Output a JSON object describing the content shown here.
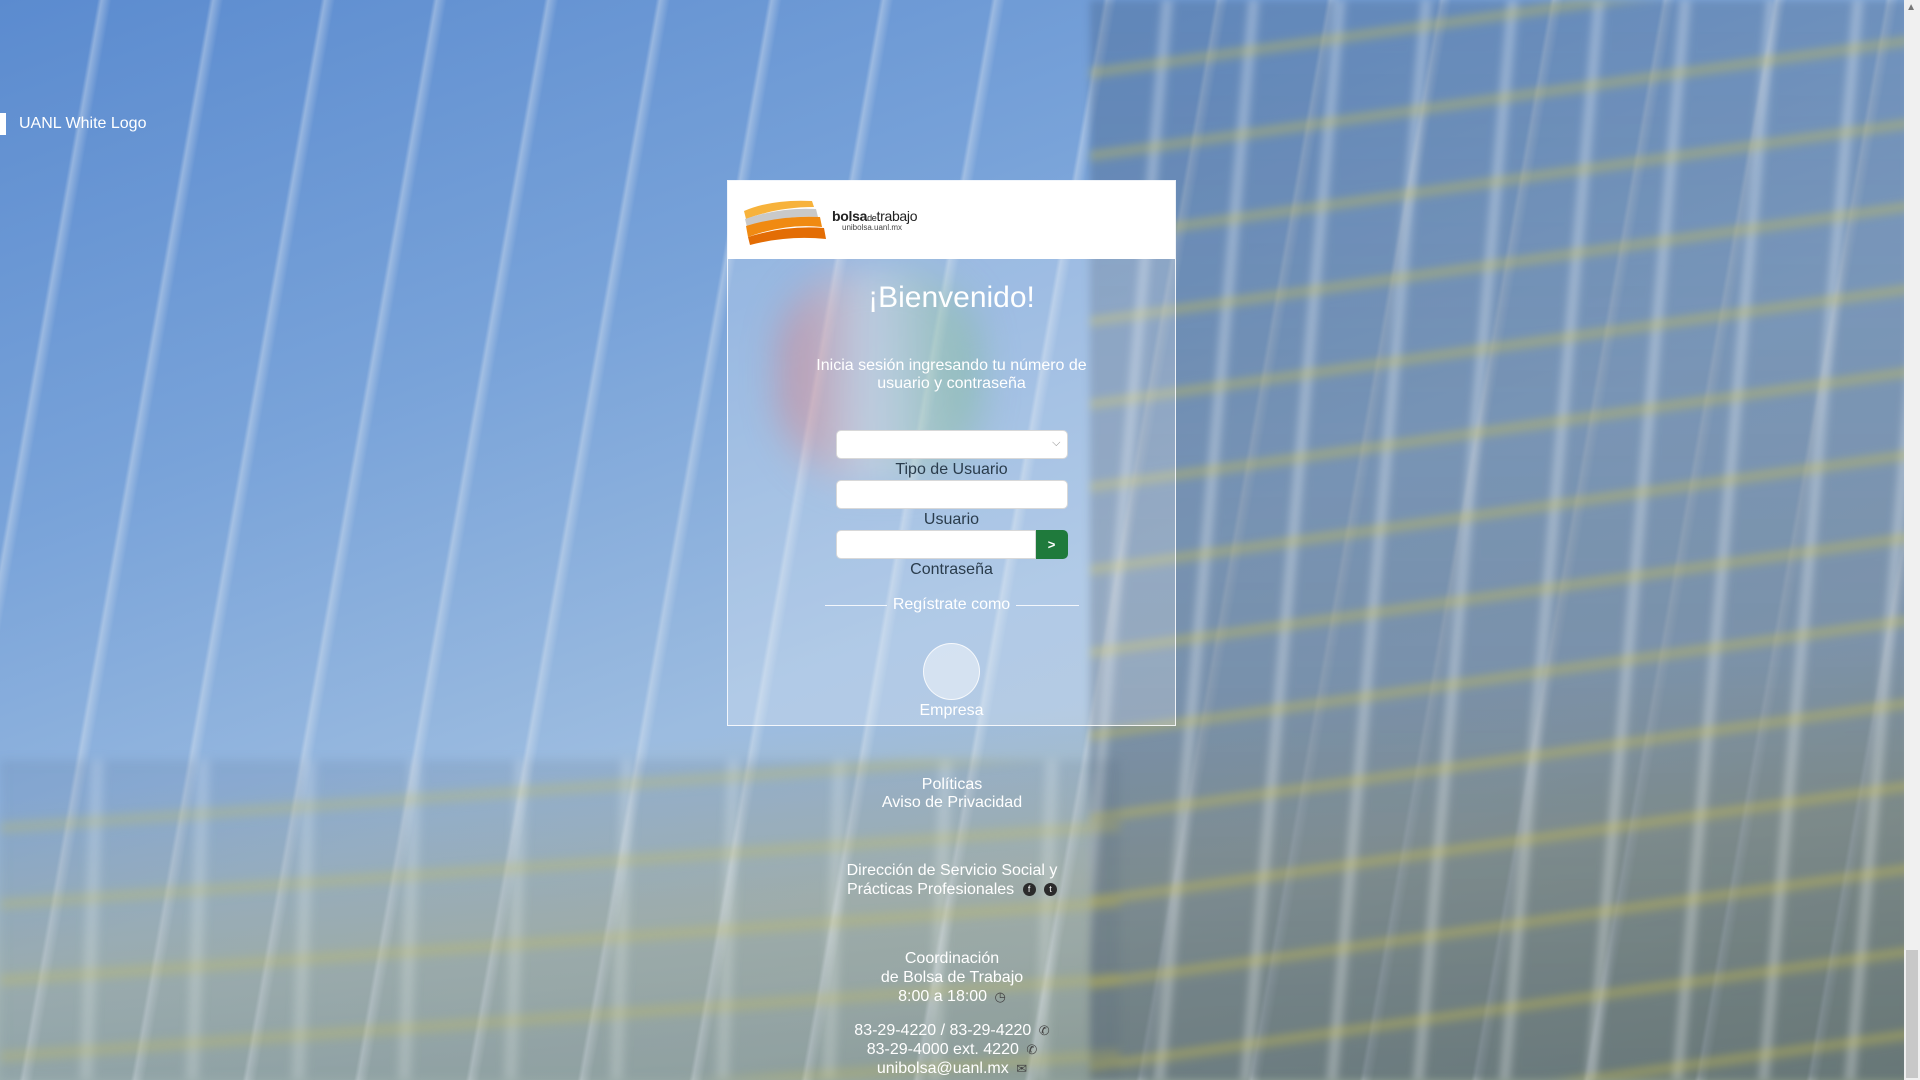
{
  "header": {
    "logo_alt": "UANL White Logo"
  },
  "brand": {
    "name_bold": "bolsa",
    "name_small": "de",
    "name_rest": "trabajo",
    "url": "unibolsa.uanl.mx"
  },
  "login": {
    "title": "¡Bienvenido!",
    "intro": "Inicia sesión ingresando tu número de usuario y contraseña",
    "user_type_label": "Tipo de Usuario",
    "user_type_value": "",
    "user_label": "Usuario",
    "user_value": "",
    "password_label": "Contraseña",
    "password_value": "",
    "submit_label": ">",
    "register_label": "Regístrate como",
    "register_option": "Empresa"
  },
  "footer": {
    "policies": "Políticas",
    "privacy": "Aviso de Privacidad",
    "department_line1": "Dirección de Servicio Social y",
    "department_line2": "Prácticas Profesionales",
    "coord_line1": "Coordinación",
    "coord_line2": "de Bolsa de Trabajo",
    "hours": "8:00 a 18:00",
    "phone1": "83-29-4220 / 83-29-4220",
    "phone2": "83-29-4000 ext. 4220",
    "email": "unibolsa@uanl.mx"
  },
  "colors": {
    "submit_green": "#1f7a3c",
    "brand_orange": "#f39a1e"
  },
  "icons": [
    "facebook-icon",
    "twitter-icon",
    "clock-icon",
    "phone-icon",
    "mail-icon",
    "chevron-down-icon"
  ]
}
